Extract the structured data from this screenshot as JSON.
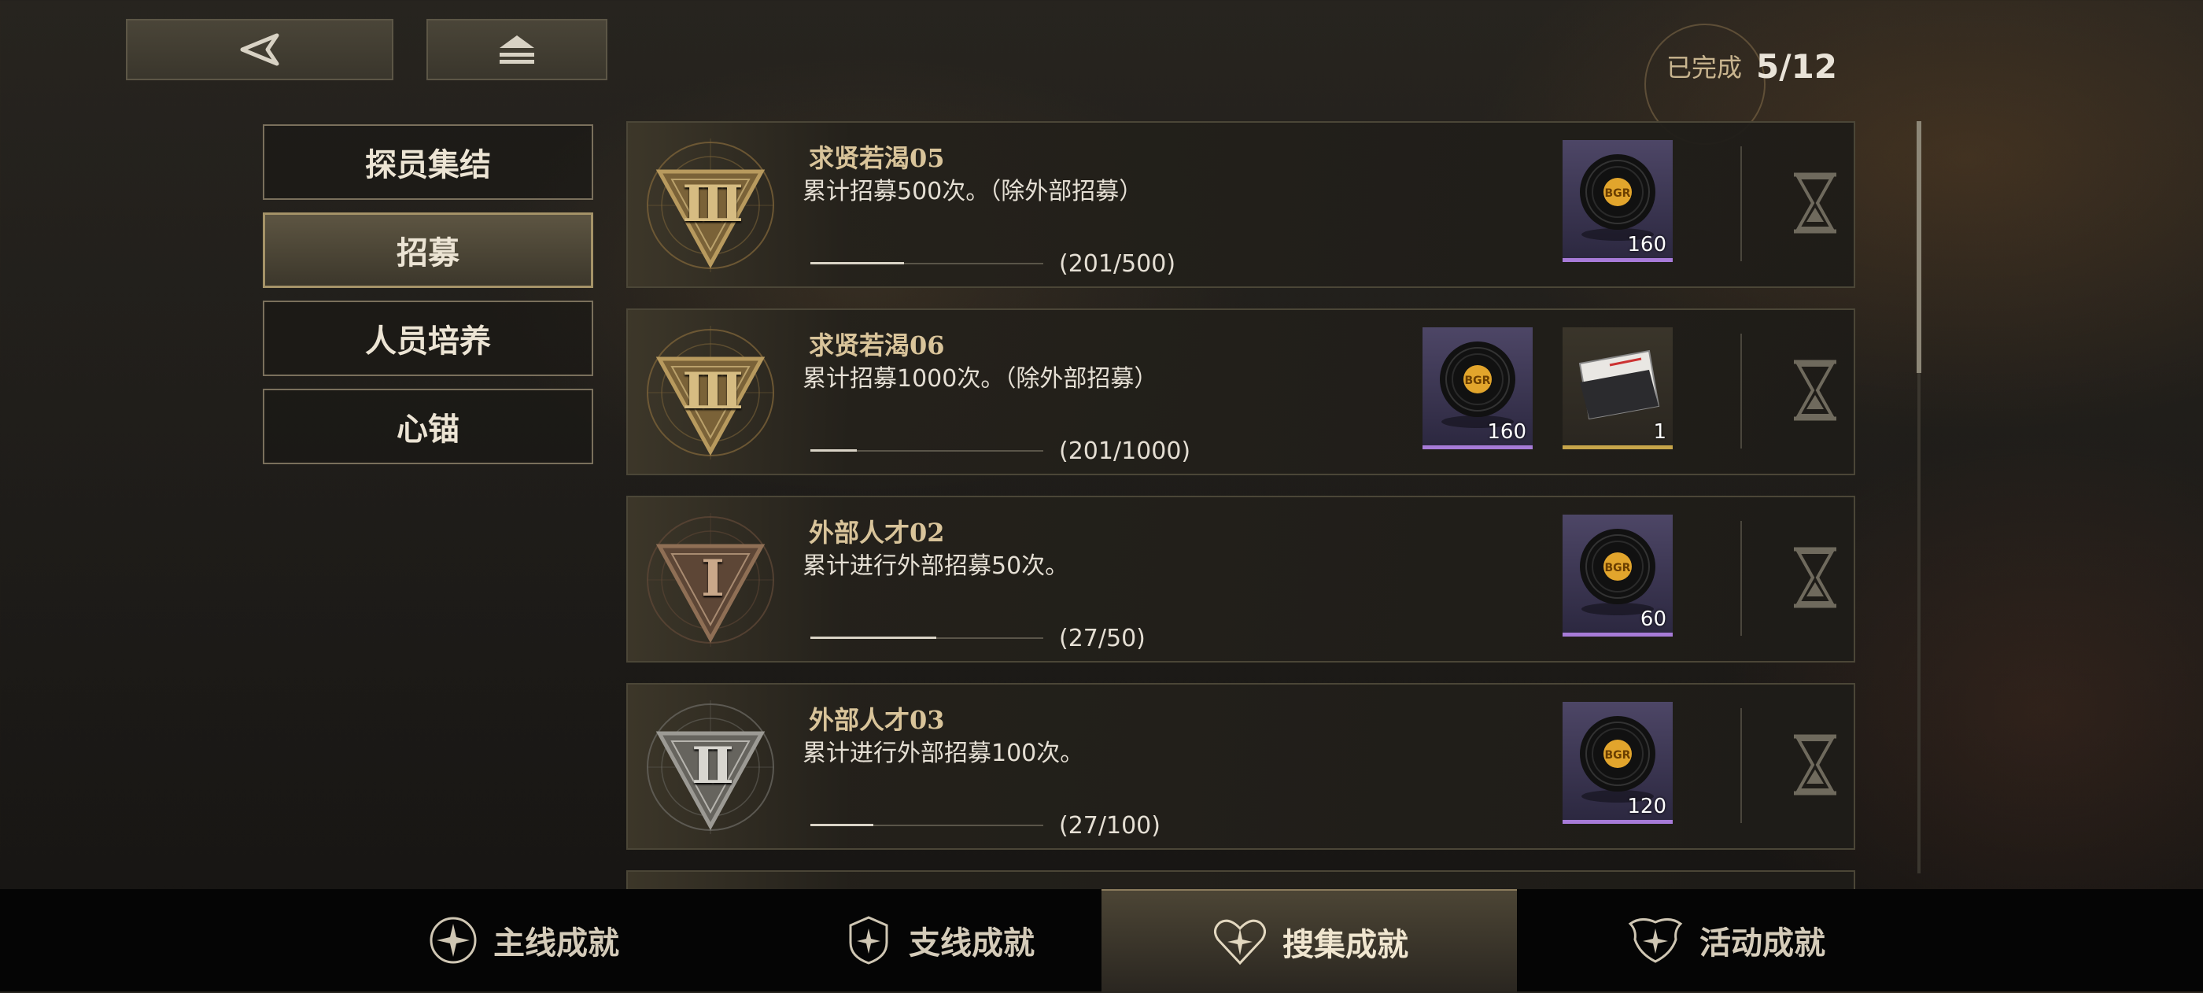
{
  "header": {
    "back_icon": "back-triangle-icon",
    "home_icon": "eject-home-icon",
    "completed_label": "已完成",
    "completed_value": "5/12"
  },
  "sidebar": {
    "items": [
      {
        "label": "探员集结",
        "active": false
      },
      {
        "label": "招募",
        "active": true
      },
      {
        "label": "人员培养",
        "active": false
      },
      {
        "label": "心锚",
        "active": false
      }
    ]
  },
  "achievements": [
    {
      "title": "求贤若渴05",
      "desc": "累计招募500次。（除外部招募）",
      "progress_text": "(201/500)",
      "progress": 0.402,
      "badge_numeral": "III",
      "badge_tier": "gold",
      "rewards": [
        {
          "type": "record-disc-icon",
          "count": "160"
        }
      ]
    },
    {
      "title": "求贤若渴06",
      "desc": "累计招募1000次。（除外部招募）",
      "progress_text": "(201/1000)",
      "progress": 0.201,
      "badge_numeral": "III",
      "badge_tier": "gold",
      "rewards": [
        {
          "type": "record-disc-icon",
          "count": "160"
        },
        {
          "type": "card-ticket-icon",
          "count": "1"
        }
      ]
    },
    {
      "title": "外部人才02",
      "desc": "累计进行外部招募50次。",
      "progress_text": "(27/50)",
      "progress": 0.54,
      "badge_numeral": "I",
      "badge_tier": "bronze",
      "rewards": [
        {
          "type": "record-disc-icon",
          "count": "60"
        }
      ]
    },
    {
      "title": "外部人才03",
      "desc": "累计进行外部招募100次。",
      "progress_text": "(27/100)",
      "progress": 0.27,
      "badge_numeral": "II",
      "badge_tier": "silver",
      "rewards": [
        {
          "type": "record-disc-icon",
          "count": "120"
        }
      ]
    }
  ],
  "tabs": [
    {
      "label": "主线成就",
      "icon": "main-star-icon",
      "active": false
    },
    {
      "label": "支线成就",
      "icon": "branch-shield-icon",
      "active": false
    },
    {
      "label": "搜集成就",
      "icon": "collection-heart-icon",
      "active": true
    },
    {
      "label": "活动成就",
      "icon": "event-wings-icon",
      "active": false
    }
  ],
  "colors": {
    "accent_gold": "#c9b58f",
    "reward_purple": "#a77bd8",
    "reward_gold": "#c7a54a"
  }
}
